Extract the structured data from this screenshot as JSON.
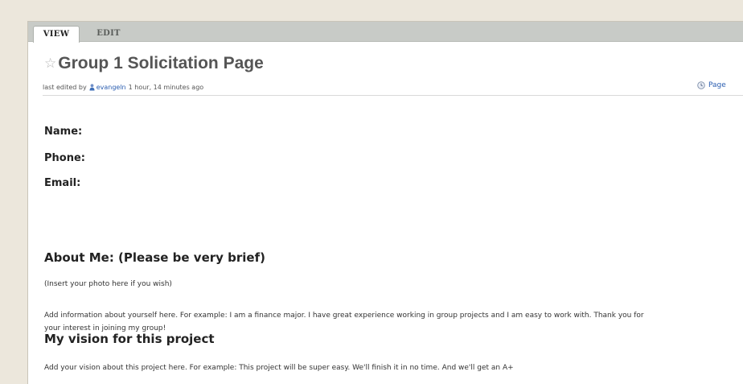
{
  "tabs": [
    {
      "label": "VIEW",
      "active": true
    },
    {
      "label": "EDIT",
      "active": false
    }
  ],
  "page": {
    "title": "Group 1 Solicitation Page",
    "meta": {
      "prefix": "last edited by",
      "user": "evangeln",
      "time": "1 hour, 14 minutes ago"
    },
    "page_link": "Page"
  },
  "content": {
    "fields": [
      "Name:",
      "Phone:",
      "Email:"
    ],
    "about_heading": "About Me: (Please be very brief)",
    "photo_note": "(Insert your photo here if you wish)",
    "about_line1": "Add information about yourself here. For example: I am a finance major. I have great experience working in group projects and I am easy to work with. Thank you for",
    "about_line2": "your interest in joining my group!",
    "vision_heading": "My vision for this project",
    "vision_text": "Add your vision about this project here. For example: This project will be super easy.  We'll finish it in no time.  And we'll get an A+"
  },
  "colors": {
    "background": "#ece7dc",
    "tabbar": "#c8cbc7",
    "link": "#2a5db0",
    "title": "#555555"
  },
  "icons": [
    "star-icon",
    "user-icon",
    "clock-icon"
  ]
}
